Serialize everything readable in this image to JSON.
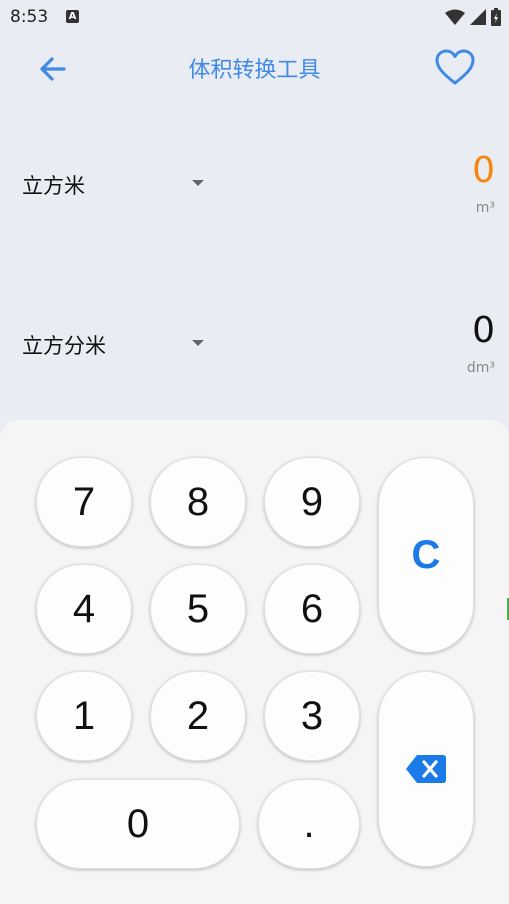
{
  "status_bar": {
    "time": "8:53",
    "notification_icon": "A"
  },
  "app_bar": {
    "title": "体积转换工具",
    "back_icon": "arrow-left-icon",
    "favorite_icon": "heart-outline-icon"
  },
  "converter": {
    "from": {
      "unit_name": "立方米",
      "value": "0",
      "symbol": "m³",
      "value_color": "#f5870f"
    },
    "to": {
      "unit_name": "立方分米",
      "value": "0",
      "symbol": "dm³",
      "value_color": "#111111"
    }
  },
  "keypad": {
    "keys": [
      "7",
      "8",
      "9",
      "4",
      "5",
      "6",
      "1",
      "2",
      "3",
      "0",
      "."
    ],
    "clear_label": "C",
    "backspace_icon": "backspace-icon",
    "accent_color": "#1a7be8"
  }
}
